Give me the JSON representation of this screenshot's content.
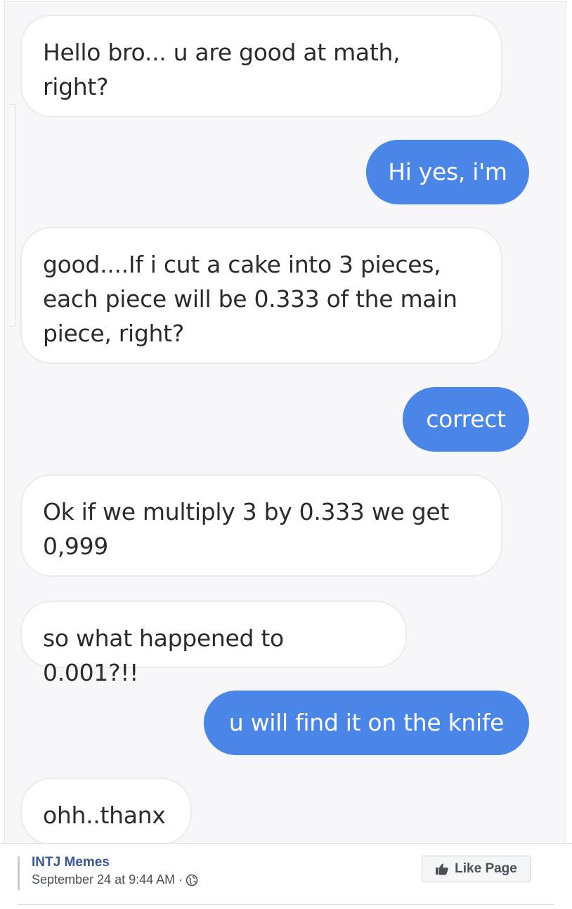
{
  "messages": [
    {
      "side": "in",
      "text": "Hello bro... u are good at math,\nright?"
    },
    {
      "side": "out",
      "text": "Hi yes, i'm"
    },
    {
      "side": "in",
      "text": "good....If i cut a cake into 3 pieces,\neach piece will be 0.333 of the main\npiece, right?"
    },
    {
      "side": "out",
      "text": "correct"
    },
    {
      "side": "in",
      "text": "Ok if we multiply 3 by 0.333 we get\n0,999"
    },
    {
      "side": "in",
      "text": "so what happened to 0.001?!!"
    },
    {
      "side": "out",
      "text": "u will find it on the knife"
    },
    {
      "side": "in",
      "text": "ohh..thanx"
    }
  ],
  "footer": {
    "page_name": "INTJ Memes",
    "timestamp": "September 24 at 9:44 AM ·",
    "like_button_label": "Like Page"
  },
  "colors": {
    "outgoing_bubble": "#4a86e8",
    "page_name_link": "#385898"
  },
  "icons": {
    "privacy": "globe-icon",
    "like": "thumbs-up-icon"
  }
}
